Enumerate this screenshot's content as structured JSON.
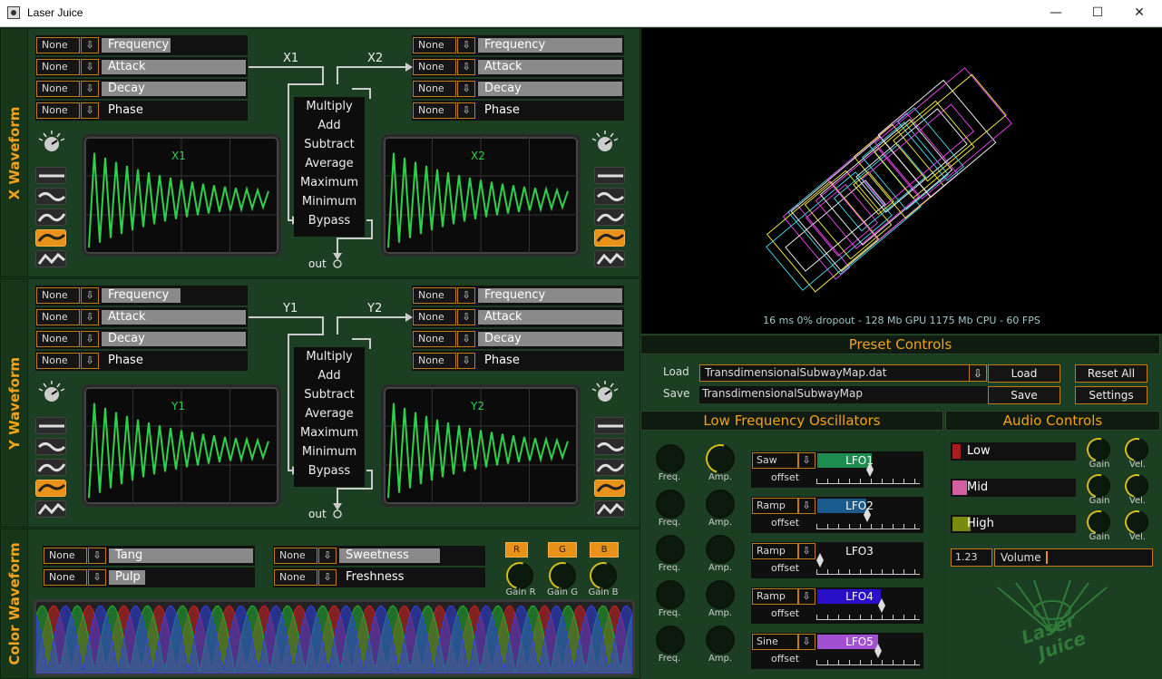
{
  "window": {
    "title": "Laser Juice",
    "min": "—",
    "max": "☐",
    "close": "✕"
  },
  "x_waveform": {
    "label": "X Waveform",
    "left_params": [
      {
        "none": "None",
        "arrow": "⇩",
        "label": "Frequency",
        "fill": 0.48
      },
      {
        "none": "None",
        "arrow": "⇩",
        "label": "Attack",
        "fill": 1.0
      },
      {
        "none": "None",
        "arrow": "⇩",
        "label": "Decay",
        "fill": 1.0
      },
      {
        "none": "None",
        "arrow": "⇩",
        "label": "Phase",
        "fill": 0.0
      }
    ],
    "right_params": [
      {
        "none": "None",
        "arrow": "⇩",
        "label": "Frequency",
        "fill": 1.0
      },
      {
        "none": "None",
        "arrow": "⇩",
        "label": "Attack",
        "fill": 1.0
      },
      {
        "none": "None",
        "arrow": "⇩",
        "label": "Decay",
        "fill": 1.0
      },
      {
        "none": "None",
        "arrow": "⇩",
        "label": "Phase",
        "fill": 0.0
      }
    ],
    "in1": "X1",
    "in2": "X2",
    "scope1": "X1",
    "scope2": "X2",
    "ops": [
      "Multiply",
      "Add",
      "Subtract",
      "Average",
      "Maximum",
      "Minimum",
      "Bypass"
    ],
    "out": "out"
  },
  "y_waveform": {
    "label": "Y Waveform",
    "left_params": [
      {
        "none": "None",
        "arrow": "⇩",
        "label": "Frequency",
        "fill": 0.55
      },
      {
        "none": "None",
        "arrow": "⇩",
        "label": "Attack",
        "fill": 1.0
      },
      {
        "none": "None",
        "arrow": "⇩",
        "label": "Decay",
        "fill": 1.0
      },
      {
        "none": "None",
        "arrow": "⇩",
        "label": "Phase",
        "fill": 0.0
      }
    ],
    "right_params": [
      {
        "none": "None",
        "arrow": "⇩",
        "label": "Frequency",
        "fill": 1.0
      },
      {
        "none": "None",
        "arrow": "⇩",
        "label": "Attack",
        "fill": 1.0
      },
      {
        "none": "None",
        "arrow": "⇩",
        "label": "Decay",
        "fill": 1.0
      },
      {
        "none": "None",
        "arrow": "⇩",
        "label": "Phase",
        "fill": 0.0
      }
    ],
    "in1": "Y1",
    "in2": "Y2",
    "scope1": "Y1",
    "scope2": "Y2",
    "ops": [
      "Multiply",
      "Add",
      "Subtract",
      "Average",
      "Maximum",
      "Minimum",
      "Bypass"
    ],
    "out": "out"
  },
  "color_waveform": {
    "label": "Color Waveform",
    "params": [
      {
        "none": "None",
        "arrow": "⇩",
        "label": "Tang",
        "fill": 1.0
      },
      {
        "none": "None",
        "arrow": "⇩",
        "label": "Pulp",
        "fill": 0.25
      },
      {
        "none": "None",
        "arrow": "⇩",
        "label": "Sweetness",
        "fill": 0.7
      },
      {
        "none": "None",
        "arrow": "⇩",
        "label": "Freshness",
        "fill": 0.0
      }
    ],
    "rgb": [
      "R",
      "G",
      "B"
    ],
    "gains": [
      "Gain R",
      "Gain G",
      "Gain B"
    ]
  },
  "stats": "16 ms  0% dropout - 128 Mb GPU  1175 Mb CPU - 60 FPS",
  "preset": {
    "title": "Preset Controls",
    "load_label": "Load",
    "save_label": "Save",
    "load_file": "TransdimensionalSubwayMap.dat",
    "save_name": "TransdimensionalSubwayMap",
    "load_btn": "Load",
    "save_btn": "Save",
    "reset_btn": "Reset All",
    "settings_btn": "Settings",
    "arrow": "⇩"
  },
  "lfo": {
    "title": "Low Frequency Oscillators",
    "freq": "Freq.",
    "amp": "Amp.",
    "offset": "offset",
    "arrow": "⇩",
    "rows": [
      {
        "type": "Saw",
        "name": "LFO1",
        "color": "#1e8c4e",
        "fill": 0.65,
        "offset": 0.5
      },
      {
        "type": "Ramp",
        "name": "LFO2",
        "color": "#1a5a8c",
        "fill": 0.58,
        "offset": 0.47
      },
      {
        "type": "Ramp",
        "name": "LFO3",
        "color": "#333333",
        "fill": 0.0,
        "offset": 0.0
      },
      {
        "type": "Ramp",
        "name": "LFO4",
        "color": "#2a0fc8",
        "fill": 0.75,
        "offset": 0.62
      },
      {
        "type": "Sine",
        "name": "LFO5",
        "color": "#a050d0",
        "fill": 0.72,
        "offset": 0.58
      }
    ]
  },
  "audio": {
    "title": "Audio Controls",
    "gain": "Gain",
    "vel": "Vel.",
    "bands": [
      {
        "label": "Low",
        "color": "#a81e1e",
        "fill": 0.07
      },
      {
        "label": "Mid",
        "color": "#d060a0",
        "fill": 0.12
      },
      {
        "label": "High",
        "color": "#7a8a10",
        "fill": 0.15
      }
    ],
    "volume_value": "1.23",
    "volume_label": "Volume"
  },
  "logo_text": "Laser Juice"
}
